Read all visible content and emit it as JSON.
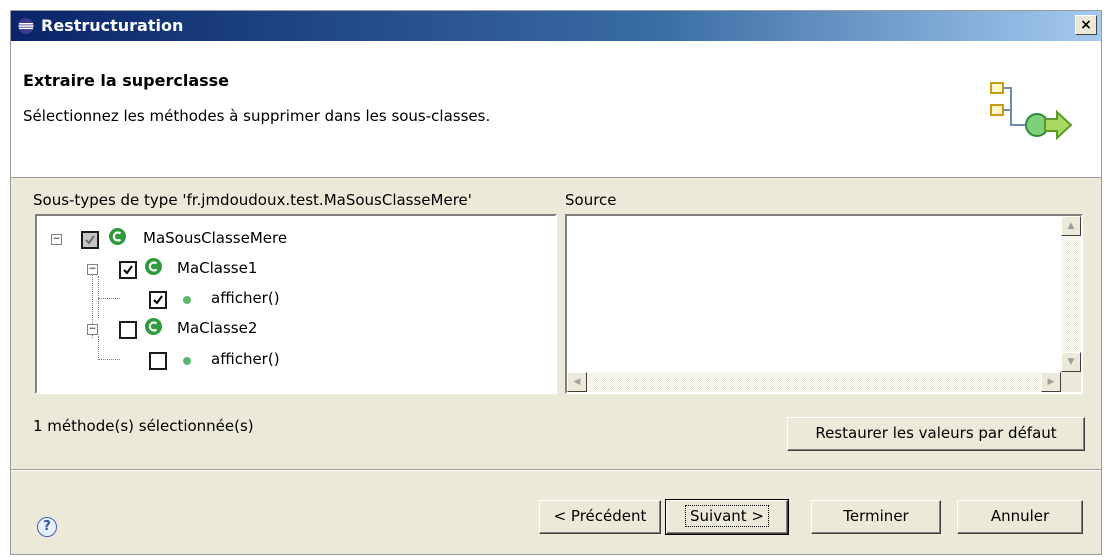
{
  "window": {
    "title": "Restructuration",
    "close_label": "×"
  },
  "banner": {
    "title": "Extraire la superclasse",
    "description": "Sélectionnez les méthodes à supprimer dans les sous-classes."
  },
  "tree_panel": {
    "label": "Sous-types de type 'fr.jmdoudoux.test.MaSousClasseMere'",
    "nodes": [
      {
        "label": "MaSousClasseMere",
        "checked": "partial"
      },
      {
        "label": "MaClasse1",
        "checked": "true"
      },
      {
        "label": "afficher()",
        "checked": "true"
      },
      {
        "label": "MaClasse2",
        "checked": "false"
      },
      {
        "label": "afficher()",
        "checked": "false"
      }
    ]
  },
  "source_panel": {
    "label": "Source"
  },
  "status": {
    "selection_count": "1 méthode(s) sélectionnée(s)"
  },
  "buttons": {
    "restore": "Restaurer les valeurs par défaut",
    "previous": "< Précédent",
    "next": "Suivant >",
    "finish": "Terminer",
    "cancel": "Annuler",
    "help": "?"
  },
  "colors": {
    "class_icon": "#2f9a3c",
    "method_icon": "#59b86a",
    "titlebar": "#0a246a"
  }
}
